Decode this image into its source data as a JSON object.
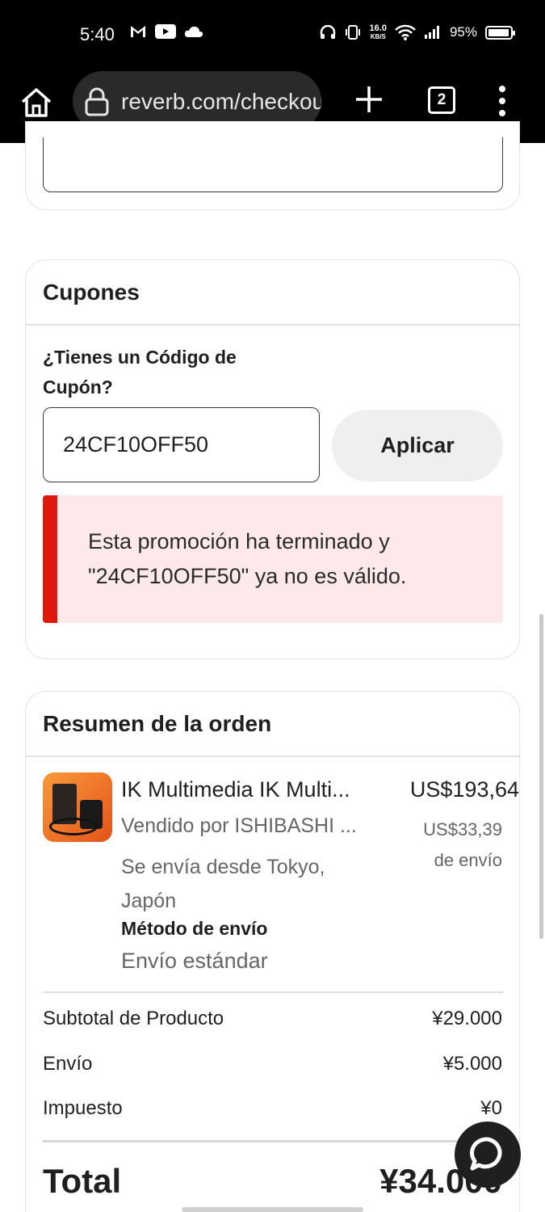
{
  "status_bar": {
    "time": "5:40",
    "speed_value": "16.0",
    "speed_unit": "KB/S",
    "battery": "95%",
    "battery_level": 0.95
  },
  "browser": {
    "url": "reverb.com/checkout",
    "tab_count": "2"
  },
  "coupons": {
    "title": "Cupones",
    "question": "¿Tienes un Código de Cupón?",
    "code_value": "24CF10OFF50",
    "apply_label": "Aplicar",
    "error_message": "Esta promoción ha terminado y \"24CF10OFF50\" ya no es válido.",
    "error_color": "#e0190f"
  },
  "summary": {
    "title": "Resumen de la orden",
    "product": {
      "name": "IK Multimedia IK Multi...",
      "price": "US$193,64",
      "seller": "Vendido por ISHIBASHI ...",
      "shipping_price": "US$33,39",
      "shipping_suffix": "de envío",
      "ships_from": "Se envía desde Tokyo, Japón",
      "shipping_method_label": "Método de envío",
      "shipping_method": "Envío estándar"
    },
    "rows": [
      {
        "label": "Subtotal de Producto",
        "value": "¥29.000"
      },
      {
        "label": "Envío",
        "value": "¥5.000"
      },
      {
        "label": "Impuesto",
        "value": "¥0"
      }
    ],
    "total_label": "Total",
    "total_value": "¥34.000"
  },
  "icons": {
    "home": "home-icon",
    "lock": "lock-icon",
    "plus": "plus-icon",
    "menu": "more-vertical-icon",
    "chat": "chat-icon"
  }
}
